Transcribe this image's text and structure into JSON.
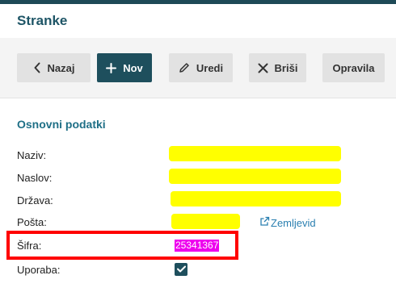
{
  "header": {
    "title": "Stranke"
  },
  "toolbar": {
    "back_label": "Nazaj",
    "new_label": "Nov",
    "edit_label": "Uredi",
    "delete_label": "Briši",
    "tasks_label": "Opravila"
  },
  "section": {
    "title": "Osnovni podatki"
  },
  "fields": {
    "naziv_label": "Naziv:",
    "naslov_label": "Naslov:",
    "drzava_label": "Država:",
    "posta_label": "Pošta:",
    "sifra_label": "Šifra:",
    "sifra_value": "25341367",
    "uporaba_label": "Uporaba:",
    "uporaba_checked": true
  },
  "links": {
    "map_label": "Zemljevid"
  },
  "colors": {
    "primary": "#1e4f5d",
    "highlight_yellow": "#ffff00",
    "highlight_magenta": "#ee00ee",
    "annotation_red": "#ff0000",
    "link": "#2a7fb0"
  },
  "icons": {
    "back": "chevron-left-icon",
    "new": "plus-icon",
    "edit": "pencil-icon",
    "delete": "close-icon",
    "map": "external-link-icon",
    "check": "check-icon"
  }
}
